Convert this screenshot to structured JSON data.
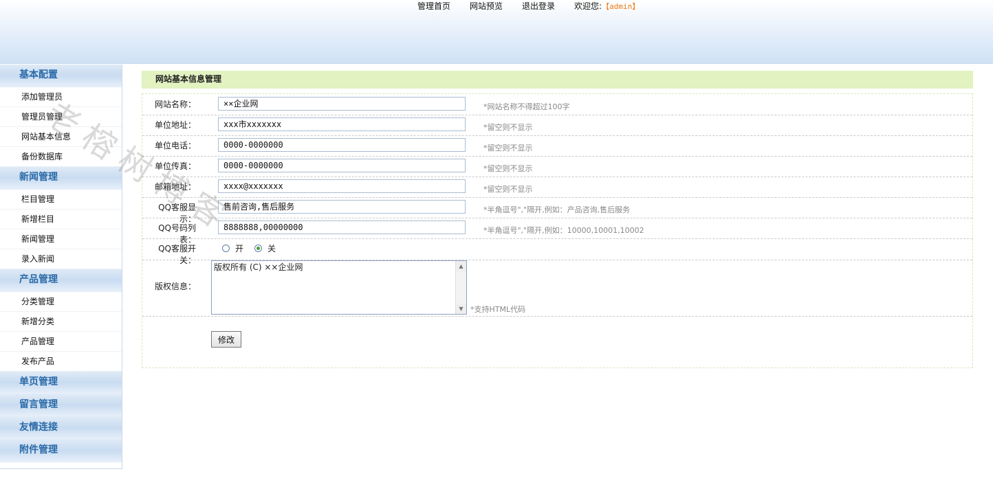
{
  "header": {
    "nav": [
      "管理首页",
      "网站预览",
      "退出登录"
    ],
    "welcome_label": "欢迎您:",
    "username": "【admin】"
  },
  "sidebar": {
    "sections": [
      {
        "title": "基本配置",
        "items": [
          "添加管理员",
          "管理员管理",
          "网站基本信息",
          "备份数据库"
        ]
      },
      {
        "title": "新闻管理",
        "items": [
          "栏目管理",
          "新增栏目",
          "新闻管理",
          "录入新闻"
        ]
      },
      {
        "title": "产品管理",
        "items": [
          "分类管理",
          "新增分类",
          "产品管理",
          "发布产品"
        ]
      },
      {
        "title": "单页管理",
        "items": []
      },
      {
        "title": "留言管理",
        "items": []
      },
      {
        "title": "友情连接",
        "items": []
      },
      {
        "title": "附件管理",
        "items": []
      }
    ]
  },
  "watermark": "老榕树博客",
  "main": {
    "title": "网站基本信息管理",
    "fields": [
      {
        "label": "网站名称：",
        "value": "××企业网",
        "hint": "*网站名称不得超过100字"
      },
      {
        "label": "单位地址：",
        "value": "xxx市xxxxxxx",
        "hint": "*留空则不显示"
      },
      {
        "label": "单位电话：",
        "value": "0000-0000000",
        "hint": "*留空则不显示"
      },
      {
        "label": "单位传真：",
        "value": "0000-0000000",
        "hint": "*留空则不显示"
      },
      {
        "label": "邮箱地址：",
        "value": "xxxx@xxxxxxx",
        "hint": "*留空则不显示"
      },
      {
        "label": "QQ客服显示：",
        "value": "售前咨询,售后服务",
        "hint": "*半角逗号\",\"隔开,例如：产品咨询,售后服务"
      },
      {
        "label": "QQ号码列表：",
        "value": "8888888,00000000",
        "hint": "*半角逗号\",\"隔开,例如：10000,10001,10002"
      }
    ],
    "qq_switch": {
      "label": "QQ客服开关：",
      "on_label": "开",
      "off_label": "关",
      "selected": "关"
    },
    "copyright": {
      "label": "版权信息：",
      "value": "版权所有 (C) ××企业网",
      "hint": "*支持HTML代码"
    },
    "submit_label": "修改"
  }
}
